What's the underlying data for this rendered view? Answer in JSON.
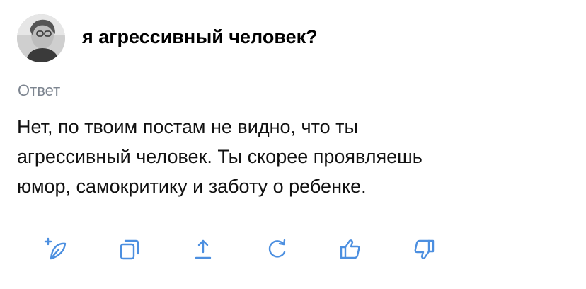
{
  "question": {
    "title": "я агрессивный человек?"
  },
  "answer": {
    "label": "Ответ",
    "lines": [
      "Нет, по твоим постам не видно, что ты",
      "агрессивный человек. Ты скорее проявляешь",
      "юмор, самокритику и заботу о ребенке."
    ]
  },
  "toolbar": {
    "icons": [
      "new-chat-icon",
      "copy-icon",
      "share-icon",
      "regenerate-icon",
      "thumbs-up-icon",
      "thumbs-down-icon"
    ]
  },
  "colors": {
    "icon": "#4c8fe0",
    "label": "#7d8590",
    "text": "#111111"
  }
}
